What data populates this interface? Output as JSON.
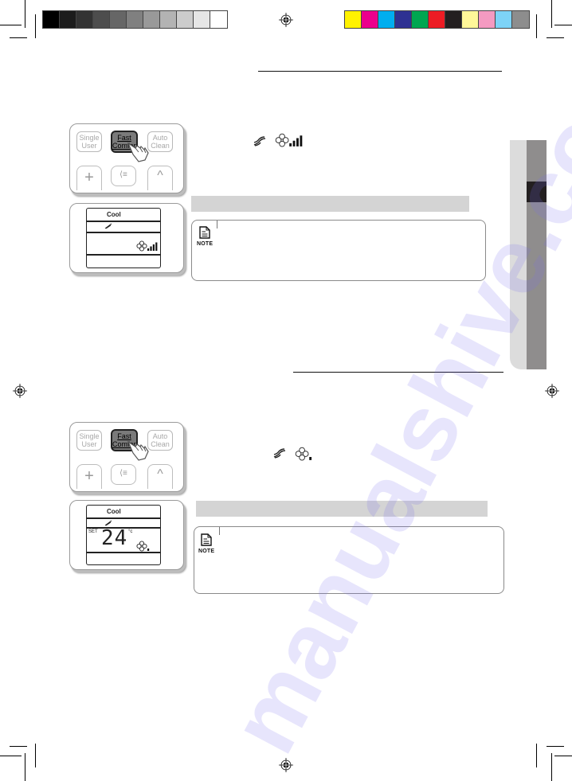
{
  "page": {
    "watermark": "manualshive.com"
  },
  "print_marks": {
    "grayscale_swatches": [
      "#000000",
      "#1c1c1c",
      "#333333",
      "#4d4d4d",
      "#666666",
      "#808080",
      "#999999",
      "#b3b3b3",
      "#cccccc",
      "#e6e6e6",
      "#ffffff"
    ],
    "color_swatches": [
      "#fff200",
      "#ec008c",
      "#00aeef",
      "#2e3192",
      "#00a651",
      "#ed1c24",
      "#231f20",
      "#fff799",
      "#f49ac1",
      "#7dd3f7",
      "#8d8d8d"
    ]
  },
  "side_tab": {
    "light_color": "#dcdcdc",
    "dark_color": "#8f8d8d",
    "active_color": "#231f20"
  },
  "sections": [
    {
      "remote": {
        "buttons": [
          {
            "line1": "Single",
            "line2": "User",
            "active": false
          },
          {
            "line1": "Fast",
            "line2": "Comfort",
            "active": true
          },
          {
            "line1": "Auto",
            "line2": "Clean",
            "active": false
          }
        ],
        "lower_buttons": [
          {
            "icon": "plus-icon",
            "glyph": "+"
          },
          {
            "icon": "airflow-direction-icon",
            "glyph": "⟨≡"
          },
          {
            "icon": "chevron-up-icon",
            "glyph": "^"
          }
        ]
      },
      "display": {
        "mode": "Cool",
        "fan_level_bars": 4,
        "fan_level_max": 4,
        "show_temperature": false
      },
      "inline_icons": [
        "wind-flow-icon",
        "fan-high-speed-icon"
      ]
    },
    {
      "remote": {
        "buttons": [
          {
            "line1": "Single",
            "line2": "User",
            "active": false
          },
          {
            "line1": "Fast",
            "line2": "Comfort",
            "active": true
          },
          {
            "line1": "Auto",
            "line2": "Clean",
            "active": false
          }
        ],
        "lower_buttons": [
          {
            "icon": "plus-icon",
            "glyph": "+"
          },
          {
            "icon": "airflow-direction-icon",
            "glyph": "⟨≡"
          },
          {
            "icon": "chevron-up-icon",
            "glyph": "^"
          }
        ]
      },
      "display": {
        "mode": "Cool",
        "set_label": "SET",
        "temperature": "24",
        "unit": "°c",
        "fan_level_bars": 1,
        "fan_level_max": 4,
        "show_temperature": true
      },
      "inline_icons": [
        "wind-flow-icon",
        "fan-low-speed-icon"
      ]
    }
  ],
  "notes": [
    {
      "label": "NOTE"
    },
    {
      "label": "NOTE"
    }
  ]
}
